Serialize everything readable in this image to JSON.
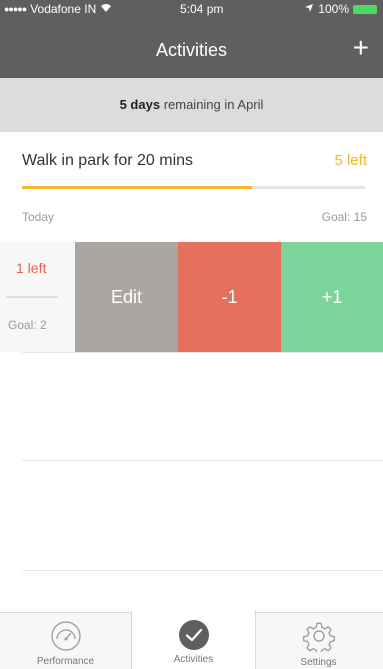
{
  "status_bar": {
    "carrier": "Vodafone IN",
    "time": "5:04 pm",
    "battery": "100%"
  },
  "nav": {
    "title": "Activities",
    "add_label": "+"
  },
  "banner": {
    "days": "5 days",
    "text": "remaining in April"
  },
  "activity": {
    "title": "Walk in park for 20 mins",
    "remaining": "5 left",
    "progress": 0.67,
    "today_label": "Today",
    "goal": "Goal: 15"
  },
  "swiped_row": {
    "remaining": "1 left",
    "goal": "Goal: 2",
    "actions": {
      "edit": "Edit",
      "minus": "-1",
      "plus": "+1"
    }
  },
  "tabs": [
    {
      "label": "Performance",
      "icon": "gauge-icon"
    },
    {
      "label": "Activities",
      "icon": "checkmark-circle-icon",
      "active": true
    },
    {
      "label": "Settings",
      "icon": "gear-icon"
    }
  ],
  "colors": {
    "header": "#5f5f5f",
    "accent_orange": "#f5b52e",
    "edit": "#aaa6a1",
    "minus": "#e5705d",
    "plus": "#7bd59b"
  }
}
